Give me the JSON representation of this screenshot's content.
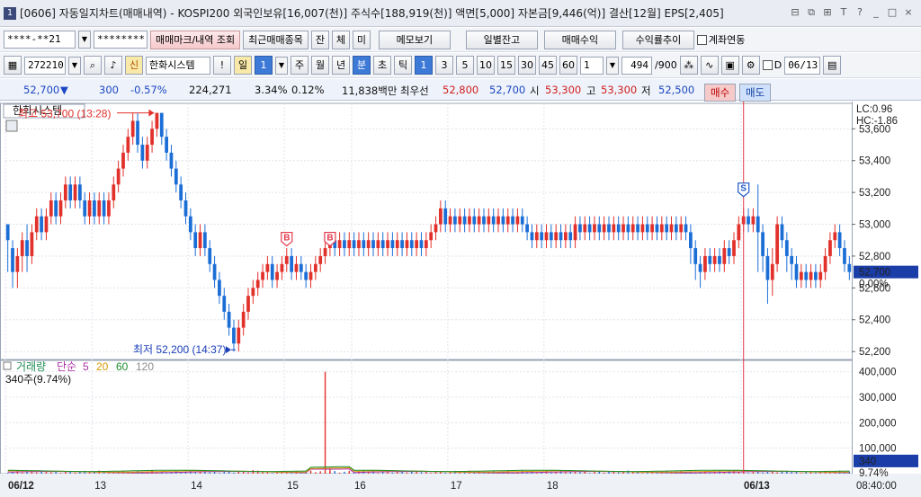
{
  "window": {
    "number": "1",
    "title": "[0606] 자동일지차트(매매내역) - KOSPI200 외국인보유[16,007(천)] 주식수[188,919(천)] 액면[5,000] 자본금[9,446(억)] 결산[12월] EPS[2,405]",
    "controls": [
      "⊟",
      "⧉",
      "⊞",
      "T",
      "?",
      "_",
      "□",
      "×"
    ]
  },
  "toolbar1": {
    "account": "****-**21",
    "password": "********",
    "trade_mark_button": "매매마크/내역 조회",
    "recent_items_button": "최근매매종목",
    "mode_buttons": [
      "잔",
      "체",
      "미"
    ],
    "memo_button": "메모보기",
    "daily_balance_button": "일별잔고",
    "trade_profit_button": "매매수익",
    "return_trend_button": "수익률추이",
    "account_link_label": "계좌연동"
  },
  "toolbar2": {
    "code": "272210",
    "new_badge": "신",
    "stock_name": "한화시스템",
    "alert_button": "!",
    "period_daily": "일",
    "period_count": "1",
    "periods": [
      "주",
      "월",
      "년",
      "분",
      "초",
      "틱"
    ],
    "minute_intervals": [
      "1",
      "3",
      "5",
      "10",
      "15",
      "30",
      "45",
      "60"
    ],
    "interval_value": "1",
    "count_display": "494",
    "count_total": "/900",
    "date_checkbox": "D",
    "date_value": "06/13"
  },
  "quote": {
    "price": "52,700",
    "direction": "▼",
    "change": "300",
    "change_pct": "-0.57%",
    "volume": "224,271",
    "pct_a": "3.34%",
    "pct_b": "0.12%",
    "amount": "11,838백만",
    "best_label": "최우선",
    "best_ask": "52,800",
    "best_bid": "52,700",
    "open_label": "시",
    "open": "53,300",
    "high_label": "고",
    "high": "53,300",
    "low_label": "저",
    "low": "52,500",
    "buy_button": "매수",
    "sell_button": "매도"
  },
  "chart_data": {
    "type": "bar",
    "title": "한화시스템",
    "price_axis": {
      "ticks": [
        "53,600",
        "53,400",
        "53,200",
        "53,000",
        "52,800",
        "52,600",
        "52,400",
        "52,200"
      ],
      "tick_values": [
        53600,
        53400,
        53200,
        53000,
        52800,
        52600,
        52400,
        52200
      ],
      "ylim": [
        52150,
        53760
      ]
    },
    "indicators": {
      "lc": "LC:0.96",
      "hc": "HC:-1.86"
    },
    "current_price": {
      "value": 52700,
      "label": "52,700",
      "pct": "0.00%"
    },
    "max_annotation": {
      "text": "최고 53,700 (13:28)",
      "value": 53700
    },
    "min_annotation": {
      "text": "최저 52,200 (14:37)",
      "value": 52200
    },
    "markers": [
      {
        "label": "B",
        "slot": 58,
        "value": 52870
      },
      {
        "label": "B",
        "slot": 67,
        "value": 52870
      },
      {
        "label": "S",
        "slot": 153,
        "value": 53180
      }
    ],
    "price_bars": [
      [
        53000,
        52900,
        52700,
        53000
      ],
      [
        52850,
        52700,
        52600,
        52900
      ],
      [
        52700,
        52800,
        52600,
        52850
      ],
      [
        52800,
        52900,
        52700,
        52950
      ],
      [
        52900,
        52800,
        52700,
        53000
      ],
      [
        52800,
        52950,
        52750,
        53000
      ],
      [
        52950,
        53050,
        52900,
        53100
      ],
      [
        53050,
        52950,
        52900,
        53100
      ],
      [
        52950,
        53050,
        52900,
        53100
      ],
      [
        53050,
        53150,
        53000,
        53200
      ],
      [
        53150,
        53050,
        53000,
        53200
      ],
      [
        53050,
        53150,
        53000,
        53200
      ],
      [
        53150,
        53250,
        53100,
        53300
      ],
      [
        53250,
        53150,
        53100,
        53300
      ],
      [
        53150,
        53250,
        53100,
        53300
      ],
      [
        53250,
        53150,
        53100,
        53300
      ],
      [
        53150,
        53050,
        53000,
        53200
      ],
      [
        53050,
        53150,
        53000,
        53200
      ],
      [
        53150,
        53050,
        53000,
        53200
      ],
      [
        53050,
        53150,
        53000,
        53200
      ],
      [
        53150,
        53050,
        53000,
        53200
      ],
      [
        53050,
        53150,
        53000,
        53200
      ],
      [
        53150,
        53250,
        53100,
        53300
      ],
      [
        53250,
        53350,
        53200,
        53400
      ],
      [
        53350,
        53450,
        53300,
        53500
      ],
      [
        53450,
        53550,
        53400,
        53600
      ],
      [
        53550,
        53650,
        53500,
        53700
      ],
      [
        53650,
        53500,
        53450,
        53700
      ],
      [
        53500,
        53400,
        53350,
        53550
      ],
      [
        53400,
        53500,
        53350,
        53550
      ],
      [
        53500,
        53600,
        53450,
        53650
      ],
      [
        53600,
        53700,
        53550,
        53700
      ],
      [
        53700,
        53550,
        53500,
        53700
      ],
      [
        53550,
        53450,
        53400,
        53600
      ],
      [
        53450,
        53350,
        53300,
        53500
      ],
      [
        53350,
        53250,
        53200,
        53400
      ],
      [
        53250,
        53150,
        53100,
        53300
      ],
      [
        53150,
        53050,
        53000,
        53200
      ],
      [
        53050,
        52950,
        52900,
        53100
      ],
      [
        52950,
        52850,
        52800,
        53000
      ],
      [
        52850,
        52950,
        52800,
        53000
      ],
      [
        52950,
        52850,
        52800,
        53000
      ],
      [
        52850,
        52750,
        52700,
        52900
      ],
      [
        52750,
        52650,
        52600,
        52800
      ],
      [
        52650,
        52550,
        52500,
        52700
      ],
      [
        52550,
        52450,
        52400,
        52600
      ],
      [
        52450,
        52350,
        52300,
        52500
      ],
      [
        52350,
        52250,
        52200,
        52400
      ],
      [
        52250,
        52350,
        52200,
        52400
      ],
      [
        52350,
        52450,
        52300,
        52500
      ],
      [
        52450,
        52550,
        52400,
        52600
      ],
      [
        52550,
        52600,
        52500,
        52650
      ],
      [
        52600,
        52650,
        52550,
        52700
      ],
      [
        52650,
        52700,
        52600,
        52750
      ],
      [
        52700,
        52750,
        52650,
        52800
      ],
      [
        52750,
        52650,
        52600,
        52800
      ],
      [
        52650,
        52700,
        52600,
        52750
      ],
      [
        52700,
        52750,
        52650,
        52800
      ],
      [
        52750,
        52800,
        52700,
        52850
      ],
      [
        52800,
        52700,
        52650,
        52850
      ],
      [
        52700,
        52750,
        52650,
        52800
      ],
      [
        52750,
        52700,
        52650,
        52800
      ],
      [
        52700,
        52650,
        52600,
        52750
      ],
      [
        52650,
        52700,
        52600,
        52750
      ],
      [
        52700,
        52750,
        52650,
        52800
      ],
      [
        52750,
        52800,
        52700,
        52850
      ],
      [
        52800,
        52850,
        52750,
        52900
      ],
      [
        52850,
        52900,
        52800,
        52950
      ],
      [
        52900,
        52850,
        52800,
        52950
      ],
      [
        52850,
        52900,
        52800,
        52950
      ],
      [
        52900,
        52850,
        52800,
        52950
      ],
      [
        52850,
        52900,
        52800,
        52950
      ],
      [
        52900,
        52850,
        52800,
        52950
      ],
      [
        52850,
        52900,
        52800,
        52950
      ],
      [
        52900,
        52850,
        52800,
        52950
      ],
      [
        52850,
        52900,
        52800,
        52950
      ],
      [
        52900,
        52850,
        52800,
        52950
      ],
      [
        52850,
        52900,
        52800,
        52950
      ],
      [
        52900,
        52850,
        52800,
        52950
      ],
      [
        52850,
        52900,
        52800,
        52950
      ],
      [
        52900,
        52850,
        52800,
        52950
      ],
      [
        52850,
        52900,
        52800,
        52950
      ],
      [
        52900,
        52850,
        52800,
        52950
      ],
      [
        52850,
        52900,
        52800,
        52950
      ],
      [
        52900,
        52850,
        52800,
        52950
      ],
      [
        52850,
        52900,
        52800,
        52950
      ],
      [
        52900,
        52850,
        52800,
        52950
      ],
      [
        52850,
        52900,
        52800,
        52950
      ],
      [
        52900,
        52950,
        52850,
        53000
      ],
      [
        52950,
        53000,
        52900,
        53050
      ],
      [
        53000,
        53100,
        52950,
        53150
      ],
      [
        53100,
        53000,
        52950,
        53150
      ],
      [
        53000,
        53050,
        52950,
        53100
      ],
      [
        53050,
        53000,
        52950,
        53100
      ],
      [
        53000,
        53050,
        52950,
        53100
      ],
      [
        53050,
        53000,
        52950,
        53100
      ],
      [
        53000,
        53050,
        52950,
        53100
      ],
      [
        53050,
        53000,
        52950,
        53100
      ],
      [
        53000,
        53050,
        52950,
        53100
      ],
      [
        53050,
        53000,
        52950,
        53100
      ],
      [
        53000,
        53050,
        52950,
        53100
      ],
      [
        53050,
        53000,
        52950,
        53100
      ],
      [
        53000,
        53050,
        52950,
        53100
      ],
      [
        53050,
        53000,
        52950,
        53100
      ],
      [
        53000,
        53050,
        52950,
        53100
      ],
      [
        53050,
        53000,
        52950,
        53100
      ],
      [
        53000,
        53050,
        52950,
        53100
      ],
      [
        53050,
        53000,
        52950,
        53100
      ],
      [
        53000,
        52950,
        52900,
        53050
      ],
      [
        52950,
        52900,
        52850,
        53000
      ],
      [
        52900,
        52950,
        52850,
        53000
      ],
      [
        52950,
        52900,
        52850,
        53000
      ],
      [
        52900,
        52950,
        52850,
        53000
      ],
      [
        52950,
        52900,
        52850,
        53000
      ],
      [
        52900,
        52950,
        52850,
        53000
      ],
      [
        52950,
        52900,
        52850,
        53000
      ],
      [
        52900,
        52950,
        52850,
        53000
      ],
      [
        52950,
        52900,
        52850,
        53000
      ],
      [
        52900,
        53000,
        52850,
        53050
      ],
      [
        53000,
        52950,
        52900,
        53050
      ],
      [
        52950,
        53000,
        52900,
        53050
      ],
      [
        53000,
        52950,
        52900,
        53050
      ],
      [
        52950,
        53000,
        52900,
        53050
      ],
      [
        53000,
        52950,
        52900,
        53050
      ],
      [
        52950,
        53000,
        52900,
        53050
      ],
      [
        53000,
        52950,
        52900,
        53050
      ],
      [
        52950,
        53000,
        52900,
        53050
      ],
      [
        53000,
        52950,
        52900,
        53050
      ],
      [
        52950,
        53000,
        52900,
        53050
      ],
      [
        53000,
        52950,
        52900,
        53050
      ],
      [
        52950,
        53000,
        52900,
        53050
      ],
      [
        53000,
        52950,
        52900,
        53050
      ],
      [
        52950,
        53000,
        52900,
        53050
      ],
      [
        53000,
        52950,
        52900,
        53050
      ],
      [
        52950,
        53000,
        52900,
        53050
      ],
      [
        53000,
        52950,
        52900,
        53050
      ],
      [
        52950,
        53000,
        52900,
        53050
      ],
      [
        53000,
        52950,
        52900,
        53050
      ],
      [
        52950,
        53000,
        52900,
        53050
      ],
      [
        53000,
        52950,
        52900,
        53050
      ],
      [
        52950,
        53000,
        52900,
        53050
      ],
      [
        53000,
        52950,
        52900,
        53050
      ],
      [
        52950,
        52850,
        52750,
        53000
      ],
      [
        52850,
        52750,
        52650,
        52900
      ],
      [
        52750,
        52700,
        52600,
        52800
      ],
      [
        52700,
        52800,
        52650,
        52850
      ],
      [
        52800,
        52750,
        52700,
        52850
      ],
      [
        52750,
        52800,
        52700,
        52850
      ],
      [
        52800,
        52750,
        52700,
        52850
      ],
      [
        52750,
        52850,
        52700,
        52900
      ],
      [
        52850,
        52800,
        52750,
        52900
      ],
      [
        52800,
        52900,
        52750,
        52950
      ],
      [
        52900,
        53000,
        52850,
        53050
      ],
      [
        53000,
        53050,
        52950,
        53100
      ],
      [
        53050,
        53000,
        52950,
        53100
      ],
      [
        53000,
        53050,
        52950,
        53100
      ],
      [
        53050,
        52950,
        52700,
        53250
      ],
      [
        52950,
        52800,
        52700,
        53000
      ],
      [
        52800,
        52650,
        52500,
        52850
      ],
      [
        52650,
        52750,
        52550,
        52850
      ],
      [
        52750,
        53000,
        52700,
        53050
      ],
      [
        53000,
        52900,
        52850,
        53050
      ],
      [
        52900,
        52800,
        52700,
        52950
      ],
      [
        52800,
        52750,
        52650,
        52850
      ],
      [
        52750,
        52650,
        52600,
        52800
      ],
      [
        52650,
        52700,
        52600,
        52750
      ],
      [
        52700,
        52650,
        52600,
        52750
      ],
      [
        52650,
        52700,
        52600,
        52750
      ],
      [
        52700,
        52650,
        52600,
        52750
      ],
      [
        52650,
        52700,
        52600,
        52750
      ],
      [
        52700,
        52800,
        52650,
        52850
      ],
      [
        52800,
        52900,
        52750,
        52950
      ],
      [
        52900,
        52950,
        52850,
        53000
      ],
      [
        52950,
        52850,
        52800,
        53000
      ],
      [
        52850,
        52750,
        52700,
        52900
      ],
      [
        52750,
        52700,
        52650,
        52800
      ]
    ],
    "volume_axis": {
      "ticks": [
        "400,000",
        "300,000",
        "200,000",
        "100,000"
      ],
      "tick_values": [
        400000,
        300000,
        200000,
        100000
      ],
      "ylim": [
        0,
        420000
      ]
    },
    "volume_legend": {
      "name": "거래량",
      "ma_label": "단순",
      "periods": [
        "5",
        "20",
        "60",
        "120"
      ],
      "colors": [
        "#1e8c52",
        "#b02ea8",
        "#d79a00",
        "#1d8d2a",
        "#8b8b8b"
      ]
    },
    "volume_readout": "340주(9.74%)",
    "volume_current": {
      "value": 340,
      "label": "340",
      "pct": "9.74%"
    },
    "volume_spikes": [
      {
        "slot": 66,
        "value": 400000
      },
      {
        "slot": 30,
        "value": 12000
      },
      {
        "slot": 51,
        "value": 14000
      },
      {
        "slot": 67,
        "value": 22000
      },
      {
        "slot": 153,
        "value": 11000
      }
    ],
    "x_axis": {
      "labels": [
        "06/12",
        "13",
        "14",
        "15",
        "16",
        "17",
        "18",
        "06/13"
      ],
      "label_slots": [
        0,
        18,
        38,
        58,
        72,
        92,
        112,
        153
      ],
      "time": "08:40:00"
    }
  },
  "colors": {
    "up": "#e2302b",
    "down": "#1b6ed6",
    "marker": "#e53a4d",
    "sell_marker": "#1b55c7",
    "price_tag": "#1a3da8",
    "cursor_line": "#e53a4d",
    "grid": "#dfe3ea"
  }
}
